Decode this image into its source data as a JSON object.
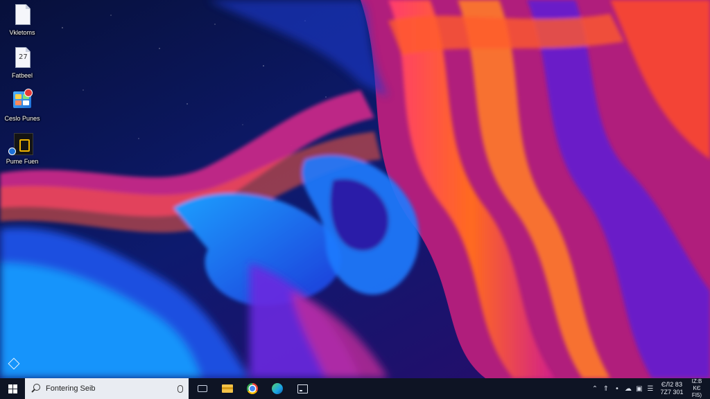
{
  "desktop": {
    "icons": [
      {
        "label": "Vkletoms",
        "icon": "document-icon"
      },
      {
        "label": "Fatbeel",
        "icon": "text-file-icon"
      },
      {
        "label": "Ceslo Punes",
        "icon": "control-panel-icon"
      },
      {
        "label": "Pume Fuen",
        "icon": "app-icon"
      }
    ]
  },
  "taskbar": {
    "search_placeholder": "Fontering Seib",
    "pinned": [
      "task-view-icon",
      "file-explorer-icon",
      "chrome-icon",
      "edge-icon",
      "terminal-icon"
    ],
    "tray": {
      "icons": [
        "chevron-up-icon",
        "network-icon",
        "volume-icon",
        "cloud-icon",
        "battery-icon",
        "keyboard-icon"
      ],
      "clock_time": "ЄЛ2 8З",
      "clock_date": "7Z7 301",
      "notification_line1": "IZ:B",
      "notification_line2": "KЄ FI5)"
    }
  },
  "colors": {
    "taskbar_bg": "#0e1424",
    "search_bg": "#e9ecf2",
    "wallpaper_dark": "#0b1240",
    "wallpaper_blue": "#1e6cff",
    "wallpaper_purple": "#7a1fd6",
    "wallpaper_orange": "#ff5a1f"
  }
}
